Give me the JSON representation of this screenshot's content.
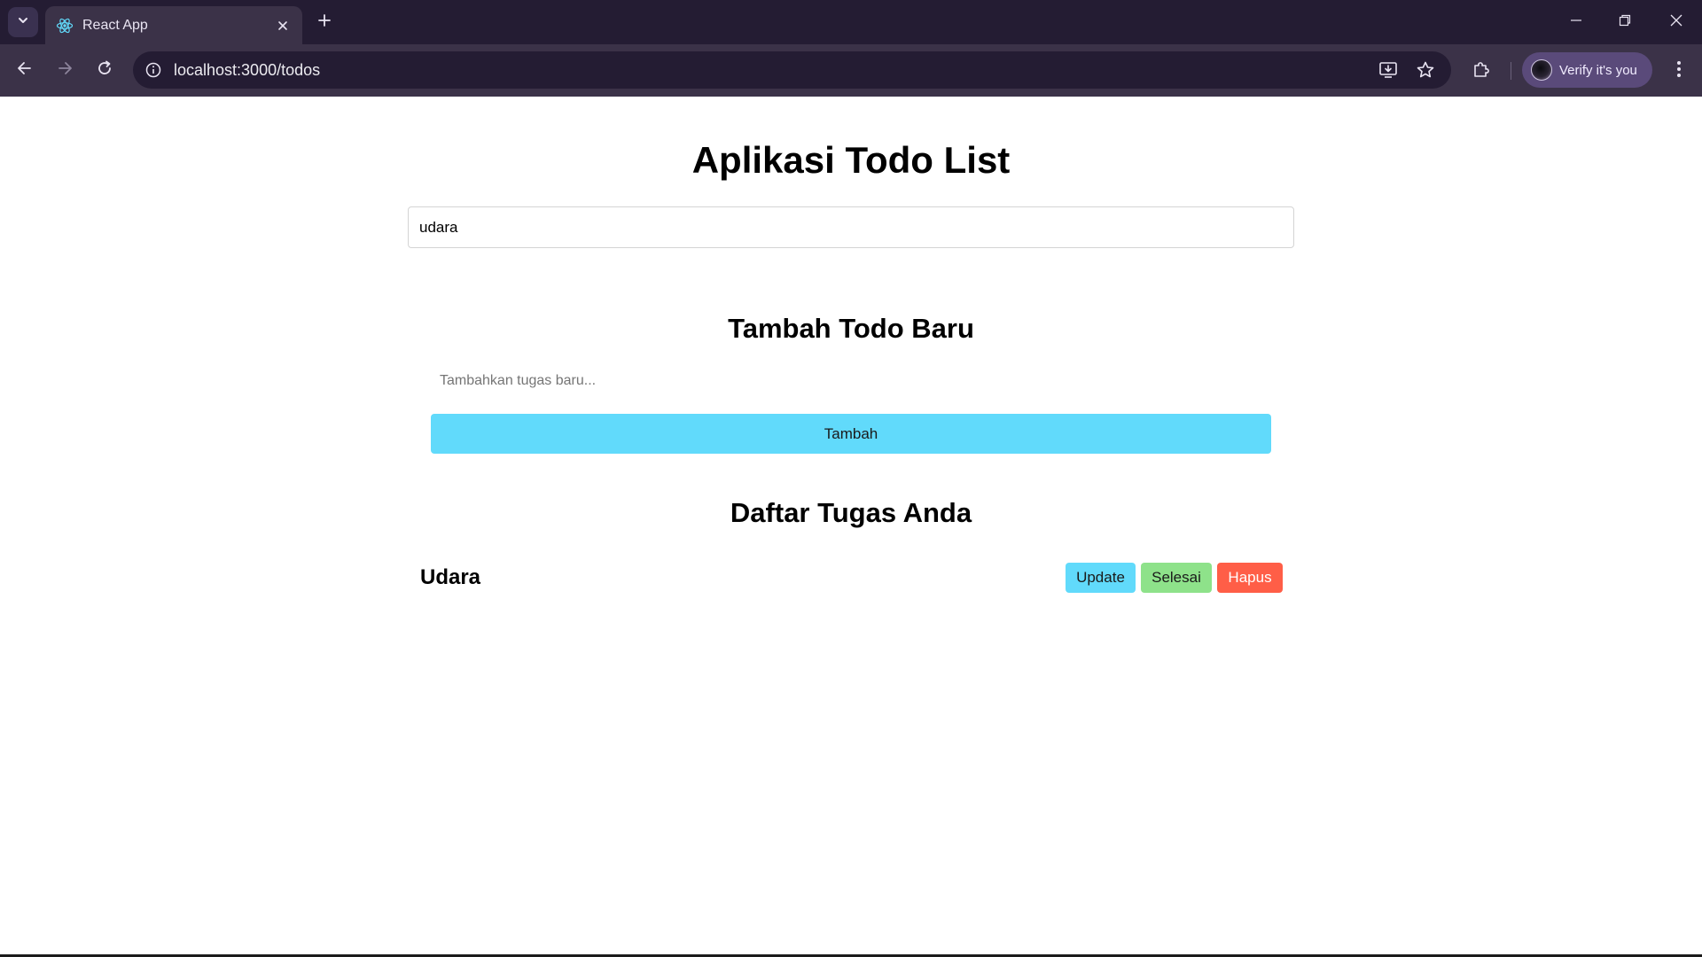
{
  "browser": {
    "tab": {
      "title": "React App",
      "favicon": "react-logo-icon"
    },
    "address_bar": {
      "url": "localhost:3000/todos"
    },
    "profile": {
      "label": "Verify it's you"
    },
    "colors": {
      "frame": "#241c33",
      "toolbar": "#3b3248",
      "profile_pill": "#5a4a7a"
    }
  },
  "app": {
    "title": "Aplikasi Todo List",
    "search": {
      "value": "udara"
    },
    "add_section": {
      "heading": "Tambah Todo Baru",
      "input_placeholder": "Tambahkan tugas baru...",
      "input_value": "",
      "button_label": "Tambah"
    },
    "list_section": {
      "heading": "Daftar Tugas Anda",
      "items": [
        {
          "text": "Udara",
          "actions": {
            "update": "Update",
            "done": "Selesai",
            "delete": "Hapus"
          }
        }
      ]
    },
    "colors": {
      "primary": "#61dafb",
      "success": "#8ee28a",
      "danger": "#ff5e47"
    }
  }
}
